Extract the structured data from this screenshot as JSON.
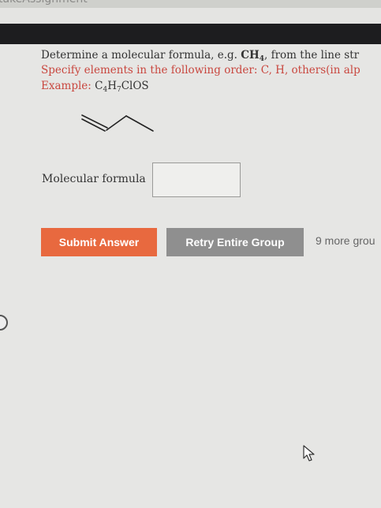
{
  "browser": {
    "url_fragment": "takeAssignment"
  },
  "question": {
    "line1_prefix": "Determine a molecular formula, e.g. ",
    "line1_formula_main": "CH",
    "line1_formula_sub": "4",
    "line1_suffix": ", from the line str",
    "line2_prefix": "Specify elements in the following order: ",
    "line2_c": "C",
    "line2_sep": ", ",
    "line2_h": "H",
    "line2_suffix": ", others(in alp",
    "line3_prefix": "Example: ",
    "example_c": "C",
    "example_c_sub": "4",
    "example_h": "H",
    "example_h_sub": "7",
    "example_rest": "ClOS"
  },
  "answer": {
    "label": "Molecular formula",
    "value": ""
  },
  "buttons": {
    "submit": "Submit Answer",
    "retry": "Retry Entire Group",
    "more_groups": "9 more grou"
  },
  "colors": {
    "submit_bg": "#e8693f",
    "retry_bg": "#8f8f8f",
    "instruction_red": "#c9473f"
  },
  "icons": {
    "cursor": "mouse-pointer-icon",
    "edge": "scroll-circle-icon"
  }
}
